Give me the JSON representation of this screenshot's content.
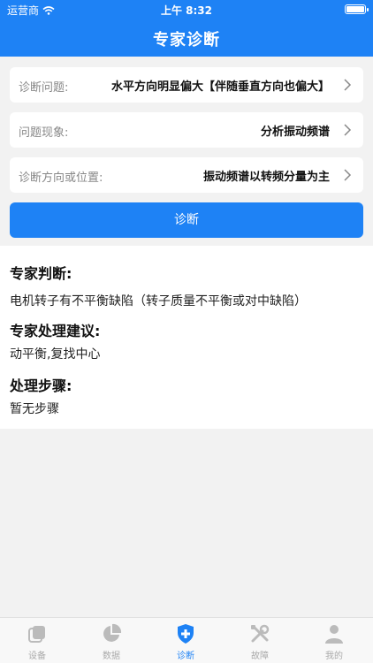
{
  "status_bar": {
    "carrier": "运营商",
    "time": "上午 8:32"
  },
  "header": {
    "title": "专家诊断"
  },
  "form": {
    "rows": [
      {
        "label": "诊断问题:",
        "value": "水平方向明显偏大【伴随垂直方向也偏大】"
      },
      {
        "label": "问题现象:",
        "value": "分析振动频谱"
      },
      {
        "label": "诊断方向或位置:",
        "value": "振动频谱以转频分量为主"
      }
    ],
    "diagnose_button": "诊断"
  },
  "result": {
    "judgment_title": "专家判断:",
    "judgment_text": "电机转子有不平衡缺陷（转子质量不平衡或对中缺陷）",
    "suggestion_title": "专家处理建议:",
    "suggestion_text": "动平衡,复找中心",
    "steps_title": "处理步骤:",
    "steps_text": "暂无步骤"
  },
  "tabbar": {
    "active": "诊断",
    "accent": "#1e82f5",
    "items": [
      {
        "label": "设备",
        "icon": "device-icon"
      },
      {
        "label": "数据",
        "icon": "pie-chart-icon"
      },
      {
        "label": "诊断",
        "icon": "shield-plus-icon"
      },
      {
        "label": "故障",
        "icon": "tools-icon"
      },
      {
        "label": "我的",
        "icon": "person-icon"
      }
    ]
  }
}
